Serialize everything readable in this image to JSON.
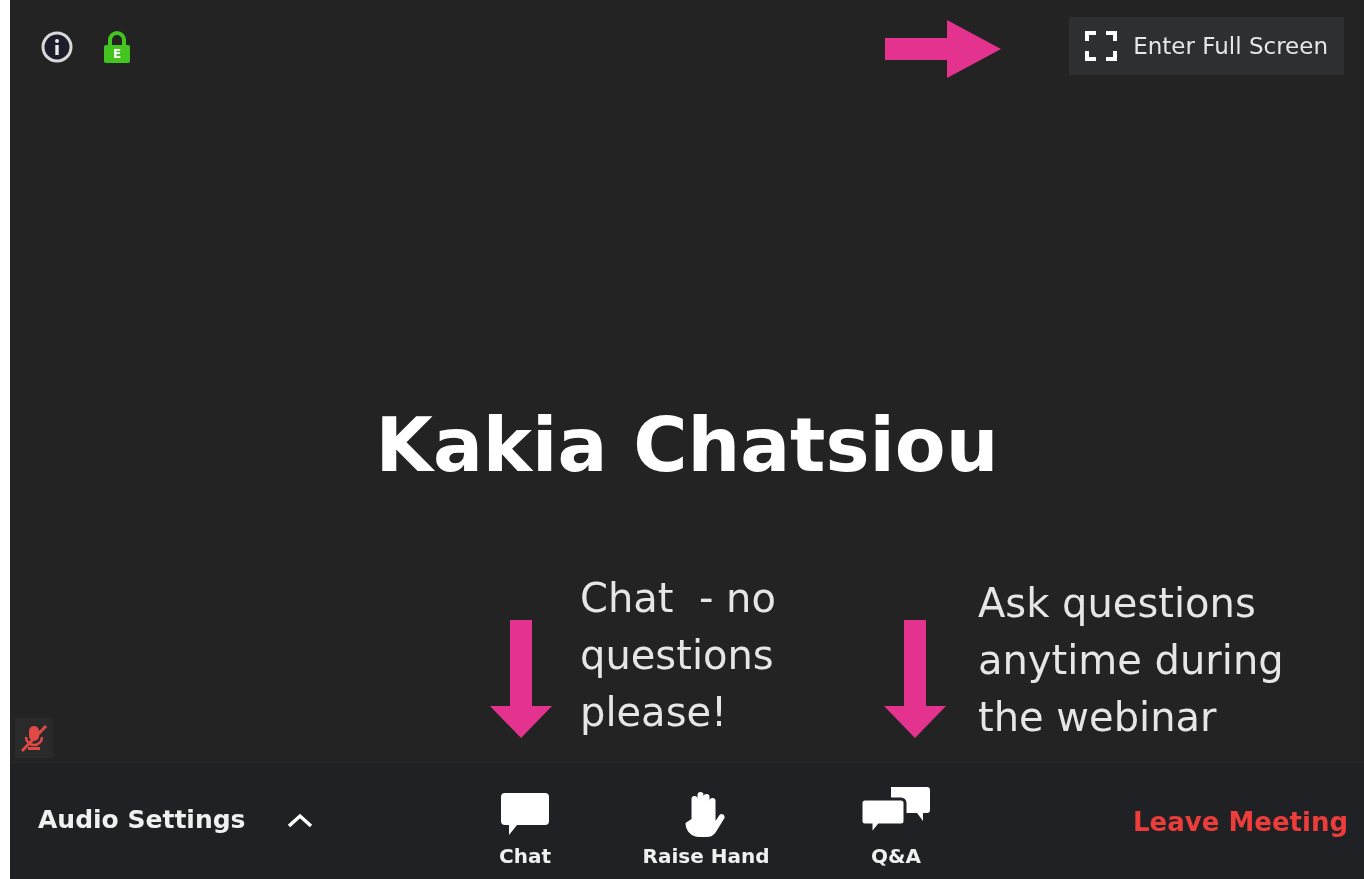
{
  "top_bar": {
    "lock_label": "E",
    "fullscreen_button": "Enter Full Screen"
  },
  "participant_name": "Kakia Chatsiou",
  "self_view": {
    "muted": true
  },
  "annotations": [
    {
      "kind": "right"
    },
    {
      "kind": "down",
      "text": "Chat  - no\nquestions\nplease!"
    },
    {
      "kind": "down",
      "text": "Ask questions\nanytime during\nthe webinar"
    }
  ],
  "toolbar": {
    "audio_settings": "Audio Settings",
    "buttons": [
      {
        "kind": "chat",
        "label": "Chat"
      },
      {
        "kind": "hand",
        "label": "Raise Hand"
      },
      {
        "kind": "qa",
        "label": "Q&A"
      }
    ],
    "leave": "Leave Meeting"
  }
}
